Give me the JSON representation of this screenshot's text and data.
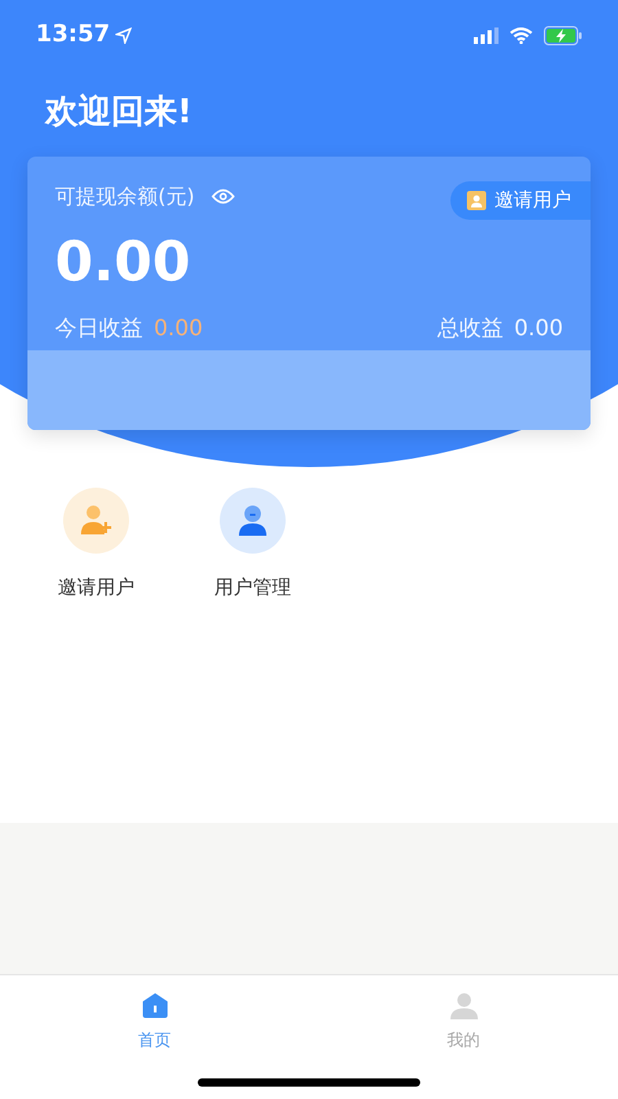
{
  "status_bar": {
    "time": "13:57"
  },
  "title": "欢迎回来!",
  "balance_card": {
    "label": "可提现余额(元)",
    "amount": "0.00",
    "invite_button": "邀请用户",
    "today_label": "今日收益",
    "today_value": "0.00",
    "total_label": "总收益",
    "total_value": "0.00"
  },
  "actions": [
    {
      "kind": "invite",
      "label": "邀请用户"
    },
    {
      "kind": "manage",
      "label": "用户管理"
    }
  ],
  "tabs": [
    {
      "kind": "home",
      "label": "首页",
      "selected": true
    },
    {
      "kind": "profile",
      "label": "我的",
      "selected": false
    }
  ]
}
